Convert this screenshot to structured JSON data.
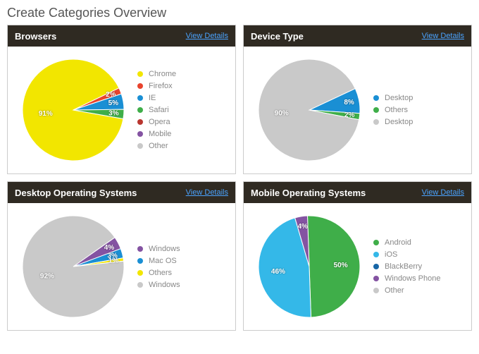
{
  "page_title": "Create Categories Overview",
  "view_details_label": "View Details",
  "panels": [
    {
      "id": "browsers",
      "title": "Browsers"
    },
    {
      "id": "device_type",
      "title": "Device Type"
    },
    {
      "id": "desktop_os",
      "title": "Desktop Operating Systems"
    },
    {
      "id": "mobile_os",
      "title": "Mobile Operating Systems"
    }
  ],
  "chart_data": [
    {
      "panel": "browsers",
      "type": "pie",
      "start_angle": 100,
      "series": [
        {
          "name": "Chrome",
          "value": 91,
          "color": "#f2e600",
          "label": "91%",
          "show_label": true
        },
        {
          "name": "Firefox",
          "value": 2,
          "color": "#e8432d",
          "label": "2%",
          "show_label": true
        },
        {
          "name": "IE",
          "value": 5,
          "color": "#1a8fd4",
          "label": "5%",
          "show_label": true
        },
        {
          "name": "Safari",
          "value": 3,
          "color": "#3fae49",
          "label": "3%",
          "show_label": true
        },
        {
          "name": "Opera",
          "value": 0,
          "color": "#b9362f",
          "label": "",
          "show_label": false
        },
        {
          "name": "Mobile",
          "value": 0,
          "color": "#8453a2",
          "label": "",
          "show_label": false
        },
        {
          "name": "Other",
          "value": 0,
          "color": "#c9c9c9",
          "label": "",
          "show_label": false
        }
      ]
    },
    {
      "panel": "device_type",
      "type": "pie",
      "start_angle": 65,
      "series": [
        {
          "name": "Desktop",
          "value": 8,
          "color": "#1a8fd4",
          "label": "8%",
          "show_label": true
        },
        {
          "name": "Others",
          "value": 2,
          "color": "#3fae49",
          "label": "2%",
          "show_label": true
        },
        {
          "name": "Desktop",
          "value": 90,
          "color": "#c9c9c9",
          "label": "90%",
          "show_label": true
        }
      ]
    },
    {
      "panel": "desktop_os",
      "type": "pie",
      "start_angle": 55,
      "series": [
        {
          "name": "Windows",
          "value": 4,
          "color": "#8453a2",
          "label": "4%",
          "show_label": true
        },
        {
          "name": "Mac OS",
          "value": 3,
          "color": "#1a8fd4",
          "label": "3%",
          "show_label": true
        },
        {
          "name": "Others",
          "value": 1,
          "color": "#f2e600",
          "label": "1%",
          "show_label": true
        },
        {
          "name": "Windows",
          "value": 92,
          "color": "#c9c9c9",
          "label": "92%",
          "show_label": true
        }
      ]
    },
    {
      "panel": "mobile_os",
      "type": "pie",
      "start_angle": 358,
      "series": [
        {
          "name": "Android",
          "value": 50,
          "color": "#3fae49",
          "label": "50%",
          "show_label": true
        },
        {
          "name": "iOS",
          "value": 46,
          "color": "#34b8e8",
          "label": "46%",
          "show_label": true
        },
        {
          "name": "BlackBerry",
          "value": 0,
          "color": "#1766a6",
          "label": "",
          "show_label": false
        },
        {
          "name": "Windows Phone",
          "value": 4,
          "color": "#8453a2",
          "label": "4%",
          "show_label": true
        },
        {
          "name": "Other",
          "value": 0,
          "color": "#c9c9c9",
          "label": "",
          "show_label": false
        }
      ]
    }
  ]
}
